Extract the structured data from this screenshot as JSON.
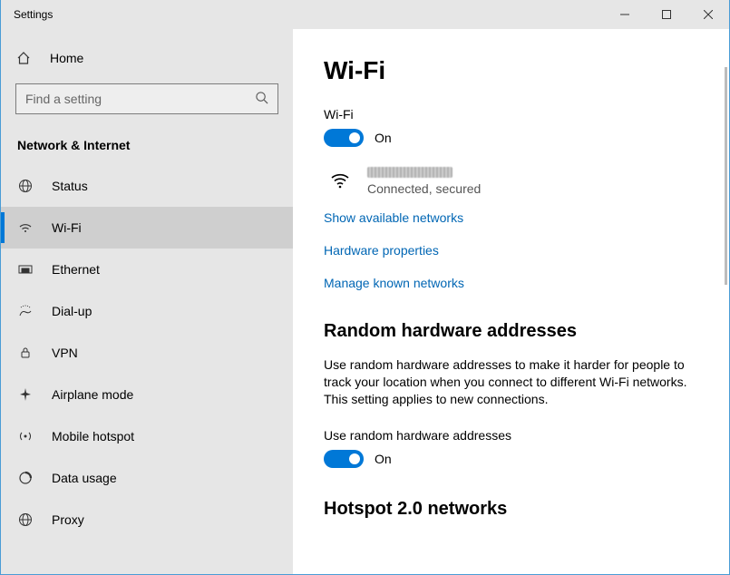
{
  "window": {
    "title": "Settings"
  },
  "sidebar": {
    "home": "Home",
    "search_placeholder": "Find a setting",
    "section": "Network & Internet",
    "items": [
      {
        "label": "Status"
      },
      {
        "label": "Wi-Fi"
      },
      {
        "label": "Ethernet"
      },
      {
        "label": "Dial-up"
      },
      {
        "label": "VPN"
      },
      {
        "label": "Airplane mode"
      },
      {
        "label": "Mobile hotspot"
      },
      {
        "label": "Data usage"
      },
      {
        "label": "Proxy"
      }
    ]
  },
  "main": {
    "title": "Wi-Fi",
    "wifi_label": "Wi-Fi",
    "wifi_toggle_state": "On",
    "network_status": "Connected, secured",
    "links": {
      "show_networks": "Show available networks",
      "hw_props": "Hardware properties",
      "manage_known": "Manage known networks"
    },
    "random_hw": {
      "heading": "Random hardware addresses",
      "desc": "Use random hardware addresses to make it harder for people to track your location when you connect to different Wi-Fi networks. This setting applies to new connections.",
      "label": "Use random hardware addresses",
      "toggle_state": "On"
    },
    "hotspot_heading": "Hotspot 2.0 networks"
  }
}
